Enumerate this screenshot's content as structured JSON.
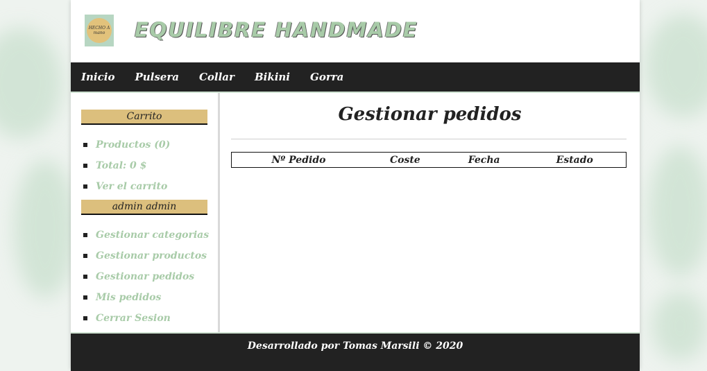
{
  "brand": {
    "logo_line1": "HECHO A",
    "logo_line2": "mano",
    "name": "EQUILIBRE HANDMADE"
  },
  "nav": {
    "items": [
      "Inicio",
      "Pulsera",
      "Collar",
      "Bikini",
      "Gorra"
    ]
  },
  "sidebar": {
    "cart_title": "Carrito",
    "cart_items": [
      "Productos (0)",
      "Total: 0 $",
      "Ver el carrito"
    ],
    "user_title": "admin admin",
    "user_items": [
      "Gestionar categorias",
      "Gestionar productos",
      "Gestionar pedidos",
      "Mis pedidos",
      "Cerrar Sesion"
    ]
  },
  "main": {
    "title": "Gestionar pedidos",
    "table_headers": [
      "Nº Pedido",
      "Coste",
      "Fecha",
      "Estado"
    ]
  },
  "footer": {
    "text": "Desarrollado por Tomas Marsili © 2020"
  },
  "colors": {
    "accent_gold": "#dcbf7d",
    "link_green": "#a8cba8",
    "dark_bar": "#222222"
  }
}
